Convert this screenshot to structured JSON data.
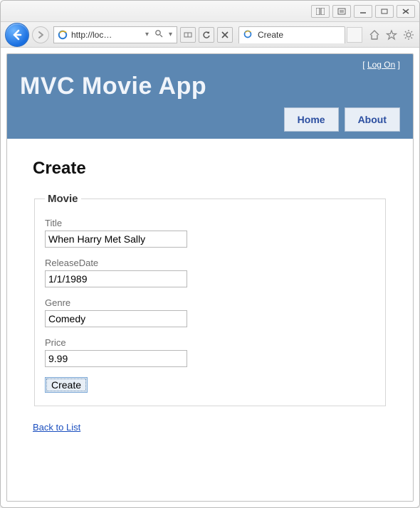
{
  "browser": {
    "url_display": "http://loc…",
    "tab_title": "Create"
  },
  "header": {
    "app_title": "MVC Movie App",
    "logon_label": "Log On",
    "nav": {
      "home": "Home",
      "about": "About"
    }
  },
  "page": {
    "heading": "Create",
    "back_link": "Back to List"
  },
  "form": {
    "legend": "Movie",
    "submit_label": "Create",
    "fields": {
      "title": {
        "label": "Title",
        "value": "When Harry Met Sally"
      },
      "releaseDate": {
        "label": "ReleaseDate",
        "value": "1/1/1989"
      },
      "genre": {
        "label": "Genre",
        "value": "Comedy"
      },
      "price": {
        "label": "Price",
        "value": "9.99"
      }
    }
  }
}
